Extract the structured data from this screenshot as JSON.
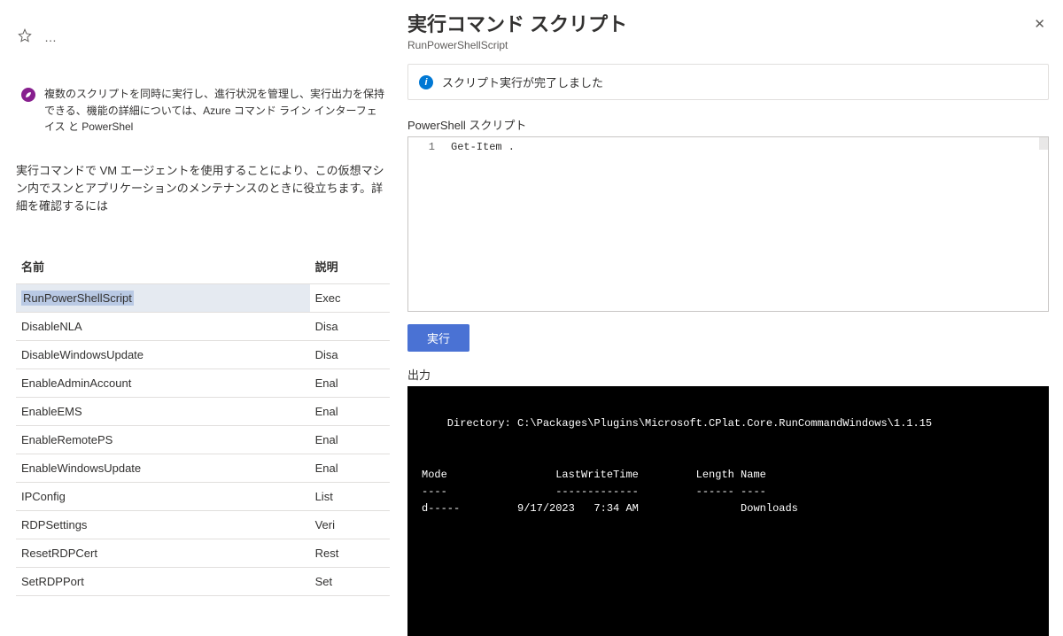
{
  "toolbar": {
    "star": "star-icon",
    "more": "…"
  },
  "banner": {
    "text": "複数のスクリプトを同時に実行し、進行状況を管理し、実行出力を保持できる、機能の詳細については、Azure コマンド ライン インターフェイス と PowerShel"
  },
  "pageDescription": "実行コマンドで VM エージェントを使用することにより、この仮想マシン内でスンとアプリケーションのメンテナンスのときに役立ちます。詳細を確認するには",
  "table": {
    "headers": {
      "name": "名前",
      "desc": "説明"
    },
    "rows": [
      {
        "name": "RunPowerShellScript",
        "desc": "Exec",
        "selected": true
      },
      {
        "name": "DisableNLA",
        "desc": "Disa"
      },
      {
        "name": "DisableWindowsUpdate",
        "desc": "Disa"
      },
      {
        "name": "EnableAdminAccount",
        "desc": "Enal"
      },
      {
        "name": "EnableEMS",
        "desc": "Enal"
      },
      {
        "name": "EnableRemotePS",
        "desc": "Enal"
      },
      {
        "name": "EnableWindowsUpdate",
        "desc": "Enal"
      },
      {
        "name": "IPConfig",
        "desc": "List"
      },
      {
        "name": "RDPSettings",
        "desc": "Veri"
      },
      {
        "name": "ResetRDPCert",
        "desc": "Rest"
      },
      {
        "name": "SetRDPPort",
        "desc": "Set "
      }
    ]
  },
  "panel": {
    "title": "実行コマンド スクリプト",
    "subtitle": "RunPowerShellScript",
    "closeGlyph": "✕",
    "status": "スクリプト実行が完了しました",
    "scriptLabel": "PowerShell スクリプト",
    "lineNumber": "1",
    "scriptBody": "Get-Item .",
    "runButton": "実行",
    "outputLabel": "出力",
    "terminal": "\n    Directory: C:\\Packages\\Plugins\\Microsoft.CPlat.Core.RunCommandWindows\\1.1.15\n\n\nMode                 LastWriteTime         Length Name\n----                 -------------         ------ ----\nd-----         9/17/2023   7:34 AM                Downloads\n"
  }
}
